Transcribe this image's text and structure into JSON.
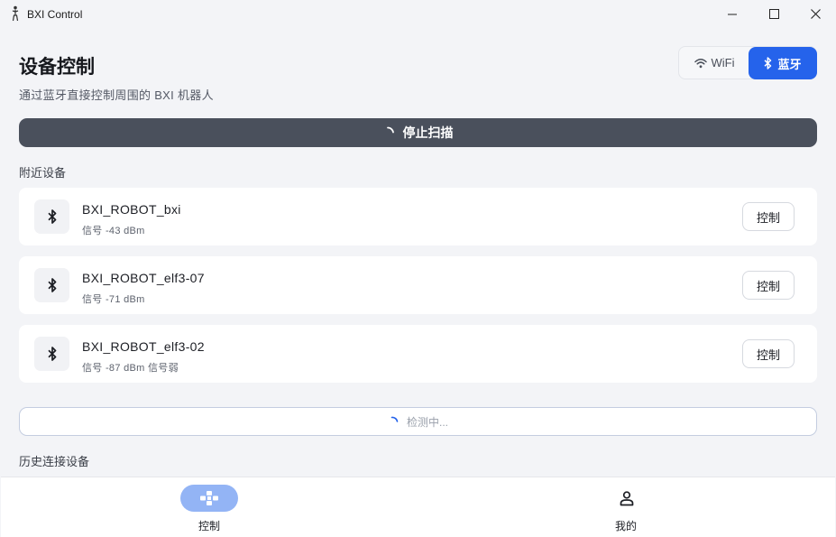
{
  "window": {
    "title": "BXI Control"
  },
  "header": {
    "title": "设备控制",
    "subtitle": "通过蓝牙直接控制周围的 BXI 机器人"
  },
  "mode_switch": {
    "wifi_label": "WiFi",
    "bluetooth_label": "蓝牙",
    "selected": "bluetooth"
  },
  "scan": {
    "button_label": "停止扫描",
    "scanning": true
  },
  "nearby": {
    "label": "附近设备",
    "devices": [
      {
        "name": "BXI_ROBOT_bxi",
        "signal": "信号 -43 dBm",
        "action": "控制"
      },
      {
        "name": "BXI_ROBOT_elf3-07",
        "signal": "信号 -71 dBm",
        "action": "控制"
      },
      {
        "name": "BXI_ROBOT_elf3-02",
        "signal": "信号 -87 dBm 信号弱",
        "action": "控制"
      }
    ]
  },
  "detecting": {
    "label": "检测中..."
  },
  "history": {
    "label": "历史连接设备"
  },
  "bottom_nav": {
    "items": [
      {
        "label": "控制",
        "icon": "gamepad-icon",
        "active": true
      },
      {
        "label": "我的",
        "icon": "person-icon",
        "active": false
      }
    ]
  },
  "colors": {
    "accent": "#2563eb",
    "scan_button": "#4a505c",
    "active_nav": "#93b4f5"
  }
}
